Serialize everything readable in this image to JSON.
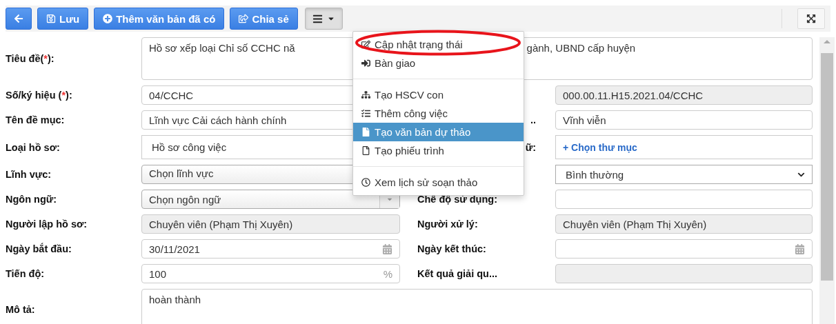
{
  "toolbar": {
    "buttons": [
      {
        "kind": "back"
      },
      {
        "kind": "save",
        "label": "Lưu"
      },
      {
        "kind": "add",
        "label": "Thêm văn bản đã có"
      },
      {
        "kind": "share",
        "label": "Chia sẻ"
      }
    ],
    "menu_button": {
      "expanded": true
    }
  },
  "form": {
    "title_row": {
      "label_before": "Tiêu đề(",
      "required": "*",
      "label_after": "):",
      "text_before": "Hồ sơ xếp loại Chỉ số CCHC nă",
      "text_after": "gành, UBND cấp huyện"
    },
    "rows": [
      {
        "left": {
          "label_before": "Số/ký hiệu (",
          "required": "*",
          "label_after": "):",
          "field": {
            "kind": "text",
            "value": "04/CCHC"
          }
        },
        "right": {
          "field": {
            "kind": "readonly",
            "value": "000.00.11.H15.2021.04/CCHC"
          }
        }
      },
      {
        "left": {
          "label_before": "Tên đề mục:",
          "field": {
            "kind": "text",
            "value": "Lĩnh vực Cải cách hành chính"
          }
        },
        "right": {
          "label_before": "..",
          "field": {
            "kind": "text",
            "value": "Vĩnh viễn"
          }
        }
      },
      {
        "left": {
          "label_before": "Loại hồ sơ:",
          "field": {
            "kind": "tall",
            "value": "Hồ sơ công việc"
          }
        },
        "right": {
          "label_before": "ữ:",
          "field": {
            "kind": "link",
            "value": "+ Chọn thư mục"
          }
        }
      },
      {
        "left": {
          "label_before": "Lĩnh vực:",
          "field": {
            "kind": "select",
            "value": "Chọn lĩnh vực"
          }
        },
        "right": {
          "field": {
            "kind": "dropdown",
            "value": "Bình thường"
          }
        }
      },
      {
        "left": {
          "label_before": "Ngôn ngữ:",
          "field": {
            "kind": "combo",
            "value": "Chọn ngôn ngữ"
          }
        },
        "right": {
          "label_before": "Chế độ sử dụng:",
          "field": {
            "kind": "text"
          }
        }
      },
      {
        "left": {
          "label_before": "Người lập hồ sơ:",
          "field": {
            "kind": "readonly",
            "value": "Chuyên viên (Phạm Thị Xuyên)"
          }
        },
        "right": {
          "label_before": "Người xử lý:",
          "field": {
            "kind": "readonly",
            "value": "Chuyên viên (Phạm Thị Xuyên)"
          }
        }
      },
      {
        "left": {
          "label_before": "Ngày bắt đầu:",
          "field": {
            "kind": "date",
            "value": "30/11/2021"
          }
        },
        "right": {
          "label_before": "Ngày kết thúc:",
          "field": {
            "kind": "date"
          }
        }
      },
      {
        "left": {
          "label_before": "Tiến độ:",
          "field": {
            "kind": "suffix",
            "value": "100",
            "suffix": "%"
          }
        },
        "right": {
          "label_before": "Kết quả giải qu...",
          "field": {
            "kind": "readonly"
          }
        }
      }
    ],
    "description": {
      "label": "Mô tả:",
      "value": "hoàn thành"
    }
  },
  "menu": [
    {
      "kind": "item",
      "label": "Cập nhật trạng thái",
      "selected": false,
      "circled": true
    },
    {
      "kind": "item",
      "label": "Bàn giao",
      "selected": false,
      "circled": false
    },
    {
      "kind": "divider"
    },
    {
      "kind": "item",
      "label": "Tạo HSCV con",
      "selected": false,
      "circled": false
    },
    {
      "kind": "item",
      "label": "Thêm công việc",
      "selected": false,
      "circled": false
    },
    {
      "kind": "item",
      "label": "Tạo văn bản dự thảo",
      "selected": true,
      "circled": false
    },
    {
      "kind": "item",
      "label": "Tạo phiếu trình",
      "selected": false,
      "circled": false
    },
    {
      "kind": "divider"
    },
    {
      "kind": "item",
      "label": "Xem lịch sử soạn thảo",
      "selected": false,
      "circled": false
    }
  ]
}
